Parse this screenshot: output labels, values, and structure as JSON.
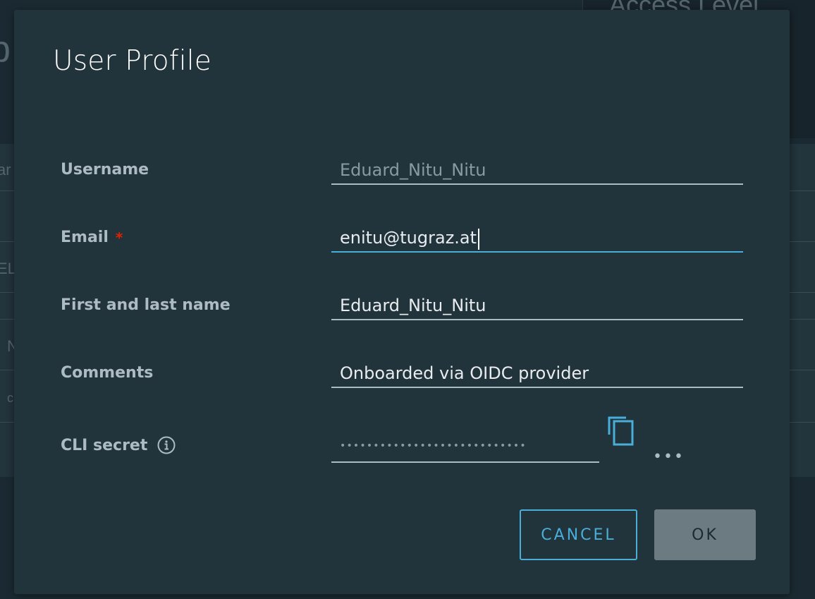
{
  "background": {
    "top_card_text": "Access Level",
    "title_fragment": "b",
    "cell_fragments": [
      "ar",
      "EL",
      "N",
      "c"
    ]
  },
  "modal": {
    "title": "User Profile",
    "fields": {
      "username": {
        "label": "Username",
        "value": "Eduard_Nitu_Nitu",
        "disabled": true
      },
      "email": {
        "label": "Email",
        "required_mark": "*",
        "value": "enitu@tugraz.at",
        "focused": true
      },
      "full_name": {
        "label": "First and last name",
        "value": "Eduard_Nitu_Nitu"
      },
      "comments": {
        "label": "Comments",
        "value": "Onboarded via OIDC provider"
      },
      "cli_secret": {
        "label": "CLI secret",
        "value": "••••••••••••••••••••••••••••",
        "more_label": "•••"
      }
    },
    "buttons": {
      "cancel": "CANCEL",
      "ok": "OK"
    }
  },
  "colors": {
    "accent": "#49afd9",
    "required": "#e02200",
    "modal_bg": "#21333b",
    "label": "#adbbc4"
  },
  "icons": {
    "info": "info-circle-icon",
    "copy": "copy-icon",
    "more": "ellipsis-icon"
  }
}
